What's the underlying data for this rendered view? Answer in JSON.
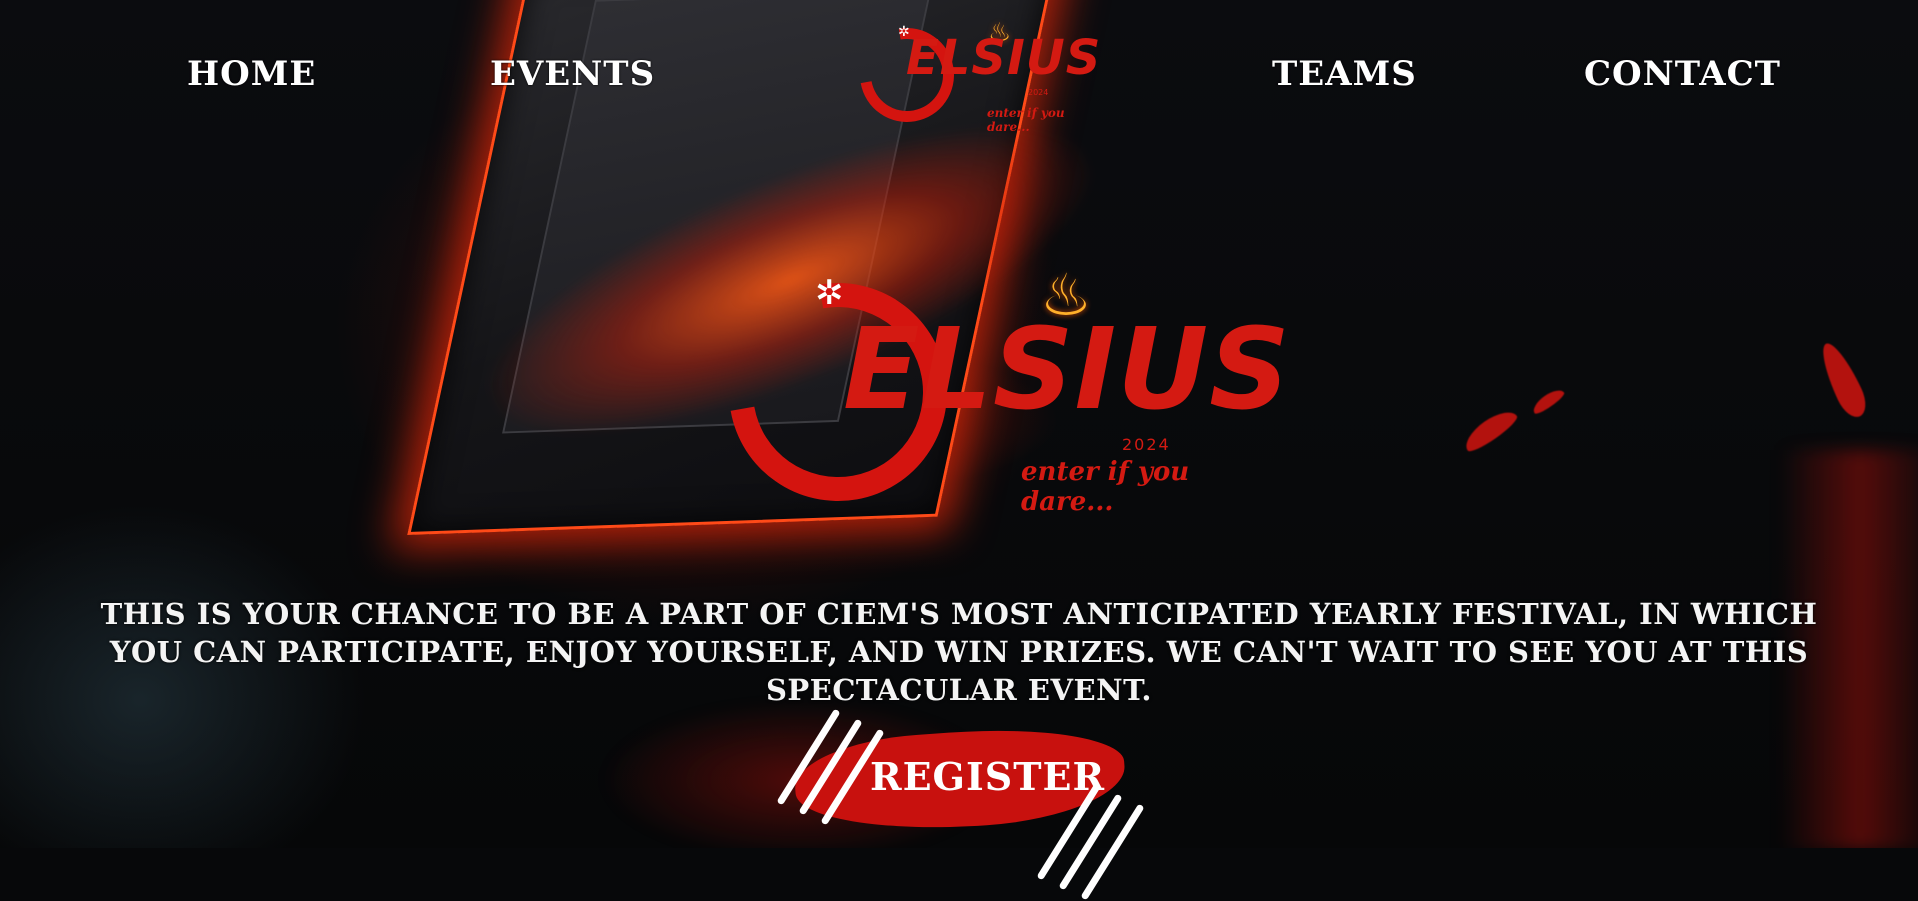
{
  "nav": {
    "home": "HOME",
    "events": "EVENTS",
    "teams": "TEAMS",
    "contact": "CONTACT"
  },
  "logo": {
    "word": "ELSIUS",
    "year": "2024",
    "tagline": "enter if you dare..."
  },
  "hero": {
    "description": "This is your chance to be a part of CIEM's most anticipated yearly festival, in which you can participate, enjoy yourself, and win prizes. We can't wait to see you at this spectacular event.",
    "register_label": "REGISTER"
  },
  "colors": {
    "brand_red": "#d41a12",
    "background": "#07080a",
    "text": "#ffffff"
  },
  "icons": [
    "spider-icon",
    "flame-icon",
    "claw-marks-icon"
  ]
}
